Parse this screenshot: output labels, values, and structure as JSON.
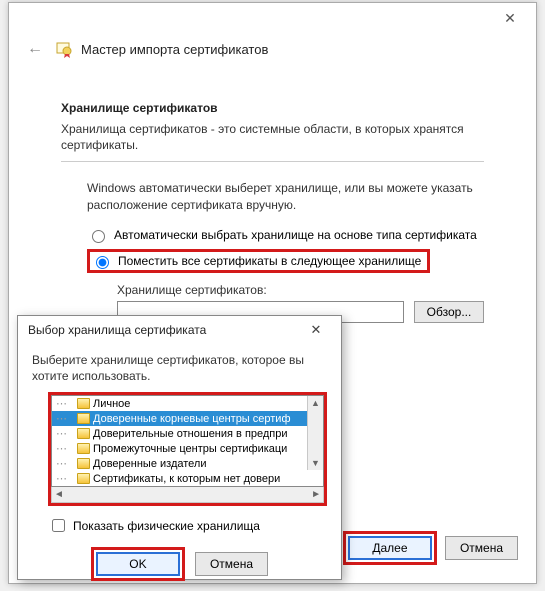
{
  "wizard": {
    "title": "Мастер импорта сертификатов",
    "section_heading": "Хранилище сертификатов",
    "section_desc": "Хранилища сертификатов - это системные области, в которых хранятся сертификаты.",
    "instruction": "Windows автоматически выберет хранилище, или вы можете указать расположение сертификата вручную.",
    "radio_auto": "Автоматически выбрать хранилище на основе типа сертификата",
    "radio_manual": "Поместить все сертификаты в следующее хранилище",
    "store_label": "Хранилище сертификатов:",
    "store_value": "",
    "browse": "Обзор...",
    "next": "Далее",
    "cancel": "Отмена"
  },
  "dialog": {
    "title": "Выбор хранилища сертификата",
    "instruction": "Выберите хранилище сертификатов, которое вы хотите использовать.",
    "tree": {
      "items": [
        "Личное",
        "Доверенные корневые центры сертиф",
        "Доверительные отношения в предпри",
        "Промежуточные центры сертификаци",
        "Доверенные издатели",
        "Сертификаты, к которым нет довери"
      ],
      "selected_index": 1
    },
    "show_physical": "Показать физические хранилища",
    "ok": "OK",
    "cancel": "Отмена"
  }
}
